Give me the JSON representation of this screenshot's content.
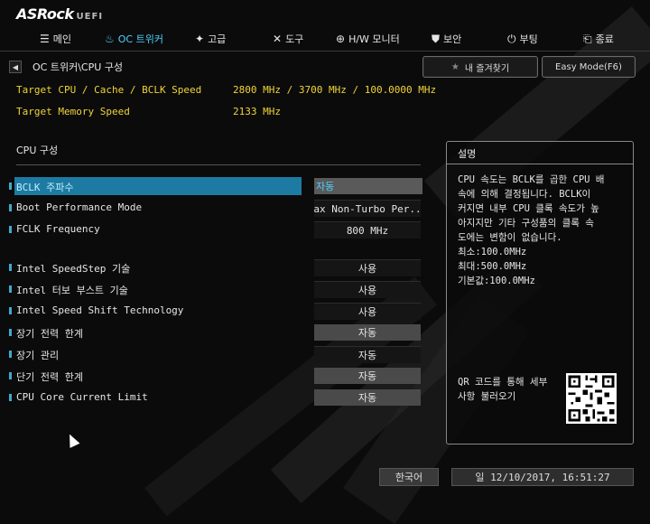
{
  "brand": {
    "name": "ASRock",
    "suffix": "UEFI"
  },
  "nav": [
    {
      "label": "메인",
      "icon": "list-icon",
      "glyph": "☰"
    },
    {
      "label": "OC 트위커",
      "icon": "flame-icon",
      "glyph": "♨"
    },
    {
      "label": "고급",
      "icon": "star-icon",
      "glyph": "✦"
    },
    {
      "label": "도구",
      "icon": "tools-icon",
      "glyph": "✕"
    },
    {
      "label": "H/W 모니터",
      "icon": "monitor-icon",
      "glyph": "⊕"
    },
    {
      "label": "보안",
      "icon": "shield-icon",
      "glyph": "⛊"
    },
    {
      "label": "부팅",
      "icon": "power-icon",
      "glyph": "⏻"
    },
    {
      "label": "종료",
      "icon": "exit-icon",
      "glyph": "⎗"
    }
  ],
  "active_tab": "OC 트위커",
  "breadcrumb": "OC 트위커\\CPU 구성",
  "favorites_label": "내 즐겨찾기",
  "easy_mode_label": "Easy Mode(F6)",
  "info": [
    {
      "label": "Target CPU / Cache / BCLK Speed",
      "value": "2800 MHz / 3700 MHz / 100.0000 MHz"
    },
    {
      "label": "Target Memory Speed",
      "value": "2133 MHz"
    }
  ],
  "section_title": "CPU 구성",
  "settings": [
    {
      "label": "BCLK 주파수",
      "value": "자동",
      "style": "sel"
    },
    {
      "label": "Boot Performance Mode",
      "value": "Max Non-Turbo Per...",
      "style": "dark"
    },
    {
      "label": "FCLK Frequency",
      "value": "800 MHz",
      "style": "dark"
    },
    {
      "label": "Intel SpeedStep 기술",
      "value": "사용",
      "style": "dark"
    },
    {
      "label": "Intel 터보 부스트 기술",
      "value": "사용",
      "style": "dark"
    },
    {
      "label": "Intel Speed Shift Technology",
      "value": "사용",
      "style": "dark"
    },
    {
      "label": "장기 전력 한계",
      "value": "자동",
      "style": "grey"
    },
    {
      "label": "장기 관리",
      "value": "자동",
      "style": "dark"
    },
    {
      "label": "단기 전력 한계",
      "value": "자동",
      "style": "grey"
    },
    {
      "label": "CPU Core Current Limit",
      "value": "자동",
      "style": "grey"
    }
  ],
  "description": {
    "title": "설명",
    "lines": [
      "CPU 속도는 BCLK를 곱한 CPU 배",
      "속에 의해 결정됩니다. BCLK이",
      "커지면 내부 CPU 클록 속도가 높",
      "아지지만 기타 구성품의 클록 속",
      "도에는 변함이 없습니다.",
      "최소:100.0MHz",
      "최대:500.0MHz",
      "기본값:100.0MHz"
    ],
    "qr_lines": [
      "QR 코드를 통해 세부",
      "사항 불러오기"
    ]
  },
  "language": "한국어",
  "datetime": "일 12/10/2017, 16:51:27",
  "colors": {
    "accent": "#4fd1ff",
    "info_text": "#f0d43a",
    "selection": "#1d7aa3"
  }
}
